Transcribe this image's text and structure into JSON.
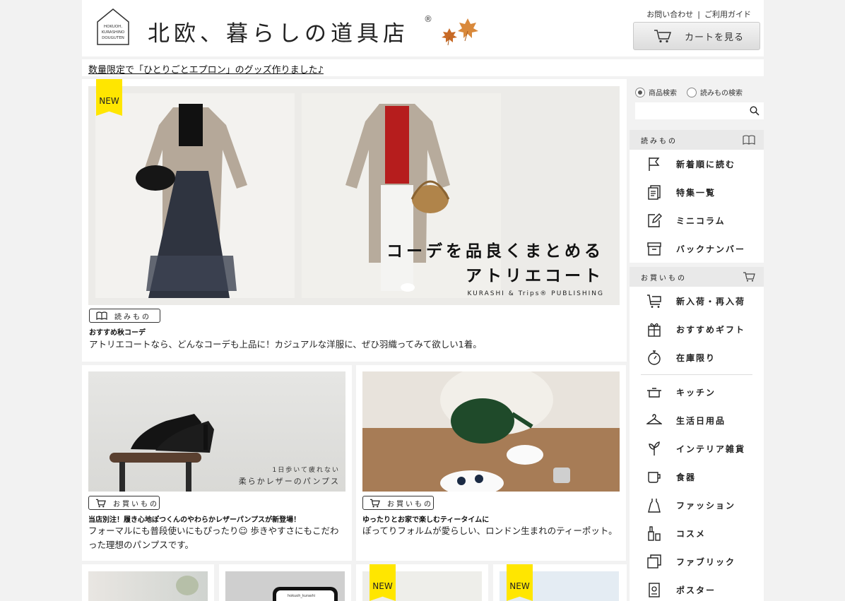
{
  "header": {
    "site_title": "北欧、暮らしの道具店",
    "registered_mark": "®",
    "logo_text_1": "HOKUOH,",
    "logo_text_2": "KURASHINO",
    "logo_text_3": "DOUGUTEN",
    "contact_label": "お問い合わせ",
    "separator": "|",
    "guide_label": "ご利用ガイド",
    "cart_label": "カートを見る"
  },
  "notice": {
    "text": "数量限定で「ひとりごとエプロン」のグッズ作りました♪"
  },
  "hero": {
    "badge": "NEW",
    "caption_line1": "コーデを品良くまとめる",
    "caption_line2": "アトリエコート",
    "publisher": "KURASHI & Trips® PUBLISHING",
    "tag": "読みもの",
    "title": "おすすめ秋コーデ",
    "description": "アトリエコートなら、どんなコーデも上品に！カジュアルな洋服に、ぜひ羽織ってみて欲しい1着。"
  },
  "cards": [
    {
      "image_caption_1": "1日歩いて疲れない",
      "image_caption_2": "柔らかレザーのパンプス",
      "tag": "お買いもの",
      "title": "当店別注！履き心地ぽつくんのやわらかレザーパンプスが新登場！",
      "description": "フォーマルにも普段使いにもぴったり☺ 歩きやすさにもこだわった理想のパンプスです。"
    },
    {
      "tag": "お買いもの",
      "title": "ゆったりとお家で楽しむティータイムに",
      "description": "ぽってりフォルムが愛らしい、ロンドン生まれのティーポット。"
    }
  ],
  "bottom_row": {
    "phone_text": "hokuoh_kurashi",
    "badges": [
      "NEW",
      "NEW"
    ]
  },
  "sidebar": {
    "search_options": [
      "商品検索",
      "読みもの検索"
    ],
    "selected_search": "商品検索",
    "search_placeholder": "",
    "read_section": "読みもの",
    "read_items": [
      "新着順に読む",
      "特集一覧",
      "ミニコラム",
      "バックナンバー"
    ],
    "shop_section": "お買いもの",
    "shop_items_top": [
      "新入荷・再入荷",
      "おすすめギフト",
      "在庫限り"
    ],
    "shop_items": [
      "キッチン",
      "生活日用品",
      "インテリア雑貨",
      "食器",
      "ファッション",
      "コスメ",
      "ファブリック",
      "ポスター"
    ]
  },
  "colors": {
    "page_bg": "#f2f2f2",
    "new_badge": "#ffe600",
    "section_header": "#e9e9e9"
  }
}
